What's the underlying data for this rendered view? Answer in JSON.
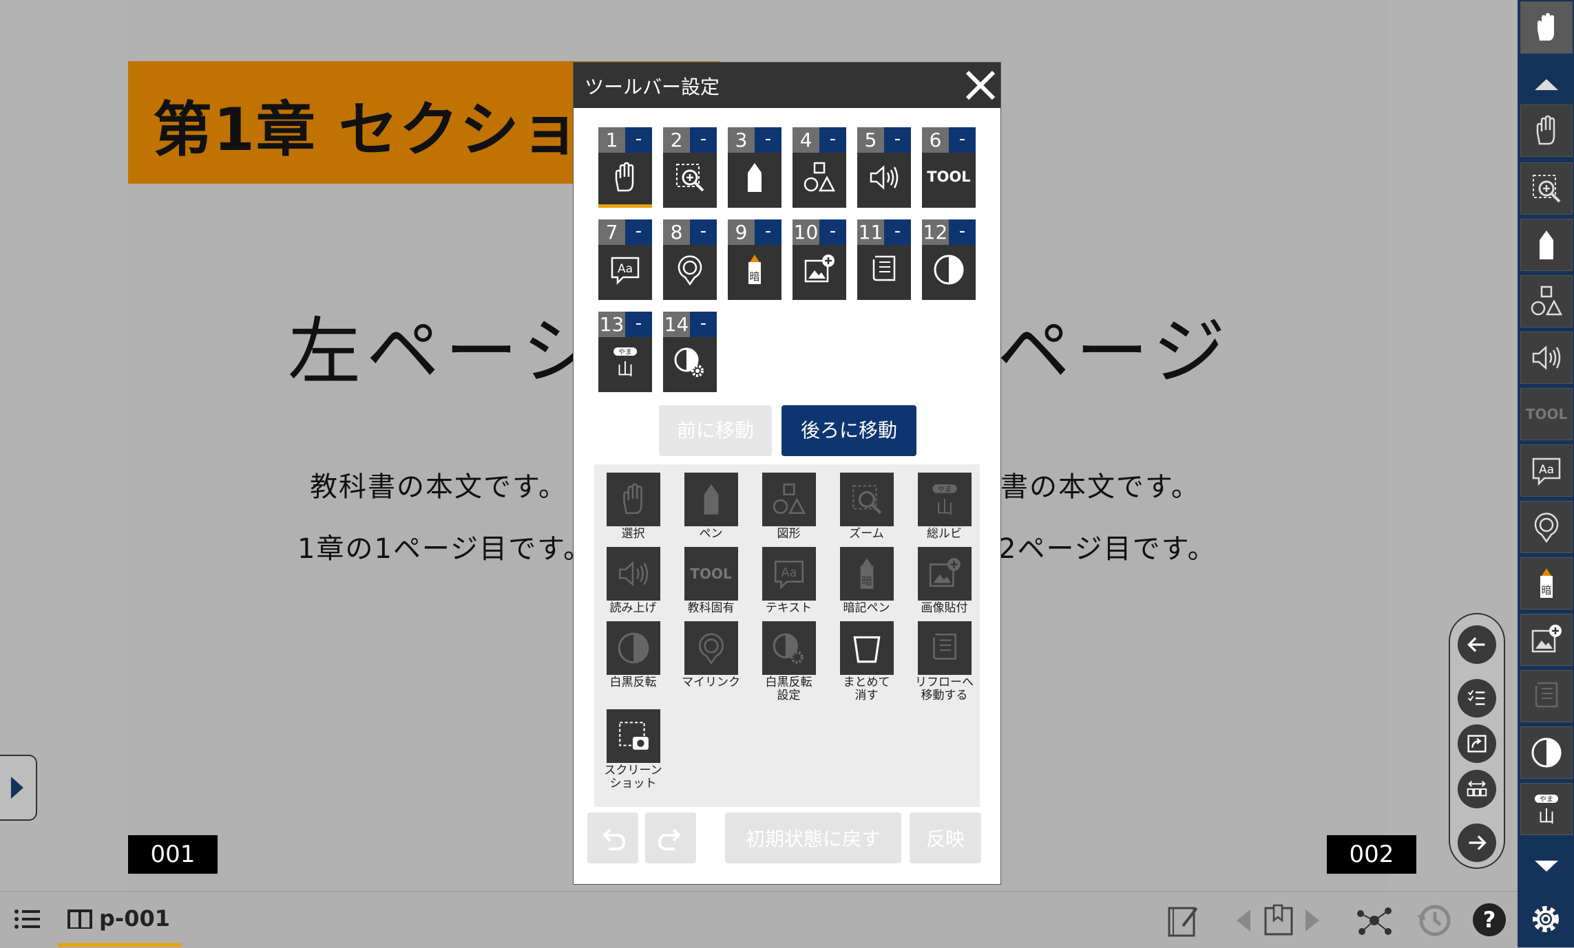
{
  "page": {
    "chapter_title": "第1章 セクショ",
    "left_big": "左ペーシ",
    "right_big": "ページ",
    "left_line1": "教科書の本文です。",
    "left_line2": "1章の1ページ目です。",
    "right_line1": "書の本文です。",
    "right_line2": "2ページ目です。",
    "left_page_number": "001",
    "right_page_number": "002"
  },
  "dialog": {
    "title": "ツールバー設定",
    "tiles": [
      {
        "num": "1",
        "minus": "-",
        "icon": "hand-icon",
        "text": ""
      },
      {
        "num": "2",
        "minus": "-",
        "icon": "zoom-icon",
        "text": ""
      },
      {
        "num": "3",
        "minus": "-",
        "icon": "pen-icon",
        "text": ""
      },
      {
        "num": "4",
        "minus": "-",
        "icon": "shapes-icon",
        "text": ""
      },
      {
        "num": "5",
        "minus": "-",
        "icon": "speaker-icon",
        "text": ""
      },
      {
        "num": "6",
        "minus": "-",
        "icon": "tool-icon",
        "text": "TOOL"
      },
      {
        "num": "7",
        "minus": "-",
        "icon": "text-icon",
        "text": "Aa"
      },
      {
        "num": "8",
        "minus": "-",
        "icon": "mylink-icon",
        "text": ""
      },
      {
        "num": "9",
        "minus": "-",
        "icon": "memorize-pen-icon",
        "text": "暗"
      },
      {
        "num": "10",
        "minus": "-",
        "icon": "image-add-icon",
        "text": ""
      },
      {
        "num": "11",
        "minus": "-",
        "icon": "reflow-icon",
        "text": ""
      },
      {
        "num": "12",
        "minus": "-",
        "icon": "invert-icon",
        "text": ""
      },
      {
        "num": "13",
        "minus": "-",
        "icon": "ruby-icon",
        "text": "やま 山"
      },
      {
        "num": "14",
        "minus": "-",
        "icon": "invert-settings-icon",
        "text": ""
      }
    ],
    "move_prev": "前に移動",
    "move_next": "後ろに移動",
    "palette": [
      {
        "label": "選択",
        "icon": "hand-icon"
      },
      {
        "label": "ペン",
        "icon": "pen-icon"
      },
      {
        "label": "図形",
        "icon": "shapes-icon"
      },
      {
        "label": "ズーム",
        "icon": "zoom-icon"
      },
      {
        "label": "総ルビ",
        "icon": "ruby-icon"
      },
      {
        "label": "読み上げ",
        "icon": "speaker-icon"
      },
      {
        "label": "教科固有",
        "icon": "tool-icon"
      },
      {
        "label": "テキスト",
        "icon": "text-icon"
      },
      {
        "label": "暗記ペン",
        "icon": "memorize-pen-icon"
      },
      {
        "label": "画像貼付",
        "icon": "image-add-icon"
      },
      {
        "label": "白黒反転",
        "icon": "invert-icon"
      },
      {
        "label": "マイリンク",
        "icon": "mylink-icon"
      },
      {
        "label": "白黒反転\n設定",
        "icon": "invert-settings-icon"
      },
      {
        "label": "まとめて\n消す",
        "icon": "trash-icon"
      },
      {
        "label": "リフローへ\n移動する",
        "icon": "reflow-icon"
      },
      {
        "label": "スクリーン\nショット",
        "icon": "screenshot-icon"
      }
    ],
    "reset_label": "初期状態に戻す",
    "apply_label": "反映",
    "tool_text": "TOOL",
    "ruby_top": "やま",
    "ruby_main": "山",
    "memo_char": "暗",
    "text_aa": "Aa"
  },
  "bottom_bar": {
    "page_label": "p-001"
  },
  "colors": {
    "chapter_bg": "#c07300",
    "toolbar_bg": "#15325a",
    "accent_blue": "#0f3571",
    "active_underline": "#e8a400"
  }
}
